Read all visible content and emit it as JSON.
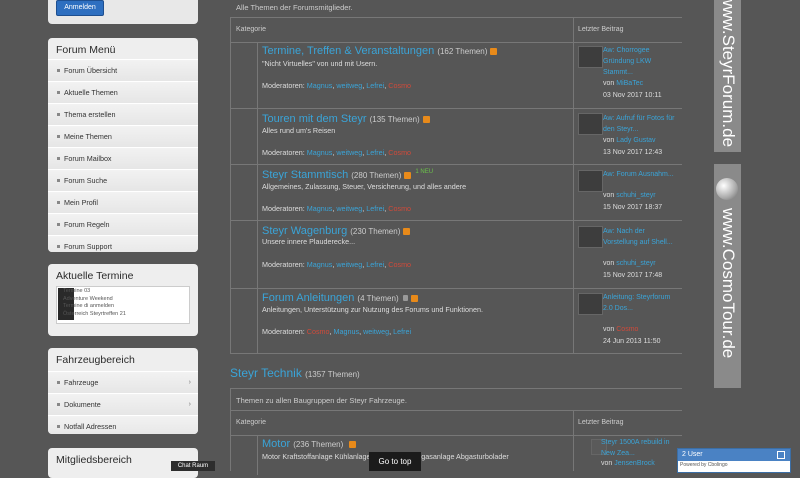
{
  "sidebar": {
    "login_label": "Anmelden",
    "forum_menu_title": "Forum Menü",
    "forum_menu_items": [
      "Forum Übersicht",
      "Aktuelle Themen",
      "Thema erstellen",
      "Meine Themen",
      "Forum Mailbox",
      "Forum Suche",
      "Mein Profil",
      "Forum Regeln",
      "Forum Support"
    ],
    "termine_title": "Aktuelle Termine",
    "termine_lines": [
      "Termine 03",
      "Adventure Weekend",
      "Termine di anmelden",
      "Österreich Steyrtreffen 21"
    ],
    "fahrzeug_title": "Fahrzeugbereich",
    "fahrzeug_items": [
      "Fahrzeuge",
      "Dokumente",
      "Notfall Adressen"
    ],
    "mitglieds_title": "Mitgliedsbereich"
  },
  "chat_tab": "Chat Raum",
  "forum": {
    "top_text": "Alle Themen der Forumsmitglieder.",
    "col_category": "Kategorie",
    "col_last": "Letzter Beitrag",
    "rows": [
      {
        "title": "Termine, Treffen & Veranstaltungen",
        "count": "(162 Themen)",
        "desc": "\"Nicht Virtuelles\" von und mit Usern.",
        "mods_label": "Moderatoren:",
        "mods": [
          "Magnus",
          "weitweg",
          "Lefrei",
          "Cosmo"
        ],
        "last_title": "Aw: Chorrogee Gründung LKW Stammt...",
        "last_by_prefix": "von",
        "last_by": "MiBaTec",
        "last_date": "03 Nov 2017 10:11"
      },
      {
        "title": "Touren mit dem Steyr",
        "count": "(135 Themen)",
        "desc": "Alles rund um's Reisen",
        "mods_label": "Moderatoren:",
        "mods": [
          "Magnus",
          "weitweg",
          "Lefrei",
          "Cosmo"
        ],
        "last_title": "Aw: Aufruf für Fotos für den Steyr...",
        "last_by_prefix": "von",
        "last_by": "Lady Gustav",
        "last_date": "13 Nov 2017 12:43"
      },
      {
        "title": "Steyr Stammtisch",
        "count": "(280 Themen)",
        "neu": "1 NEU",
        "desc": "Allgemeines, Zulassung, Steuer, Versicherung, und alles andere",
        "mods_label": "Moderatoren:",
        "mods": [
          "Magnus",
          "weitweg",
          "Lefrei",
          "Cosmo"
        ],
        "last_title": "Aw: Forum Ausnahm...",
        "last_by_prefix": "von",
        "last_by": "schuhi_steyr",
        "last_date": "15 Nov 2017 18:37"
      },
      {
        "title": "Steyr Wagenburg",
        "count": "(230 Themen)",
        "desc": "Unsere innere Plauderecke...",
        "mods_label": "Moderatoren:",
        "mods": [
          "Magnus",
          "weitweg",
          "Lefrei",
          "Cosmo"
        ],
        "last_title": "Aw: Nach der Vorstellung auf Shell...",
        "last_by_prefix": "von",
        "last_by": "schuhi_steyr",
        "last_date": "15 Nov 2017 17:48"
      },
      {
        "title": "Forum Anleitungen",
        "count": "(4 Themen)",
        "locked": true,
        "desc": "Anleitungen, Unterstützung zur Nutzung des Forums und Funktionen.",
        "mods_label": "Moderatoren:",
        "mods": [
          "Cosmo",
          "Magnus",
          "weitweg",
          "Lefrei"
        ],
        "last_title": "Anleitung: Steyrforum 2.0 Dos...",
        "last_by_prefix": "von",
        "last_by": "Cosmo",
        "last_date": "24 Jun 2013 11:50"
      }
    ],
    "section2_title": "Steyr Technik",
    "section2_count": "(1357 Themen)",
    "section2_top_text": "Themen zu allen Baugruppen der Steyr Fahrzeuge.",
    "section2_row": {
      "title": "Motor",
      "count": "(236 Themen)",
      "desc": "Motor Kraftstoffanlage Kühlanlage Schmierung Abgasanlage Abgasturbolader",
      "last_title": "Steyr 1500A rebuild in New Zea...",
      "last_by_prefix": "von",
      "last_by": "JensenBrock"
    }
  },
  "goto_top": "Go to top",
  "banners": {
    "top_text": "www.SteyrForum.de",
    "bottom_text": "www.CosmoTour.de"
  },
  "user_widget": {
    "label": "2 User",
    "powered": "Powered by Cbolingo"
  },
  "colors": {
    "background": "#565656",
    "link_blue": "#3aa4d8",
    "moderator_red": "#d04a3a",
    "rss_orange": "#e88a1a",
    "new_green": "#6cc34a"
  }
}
